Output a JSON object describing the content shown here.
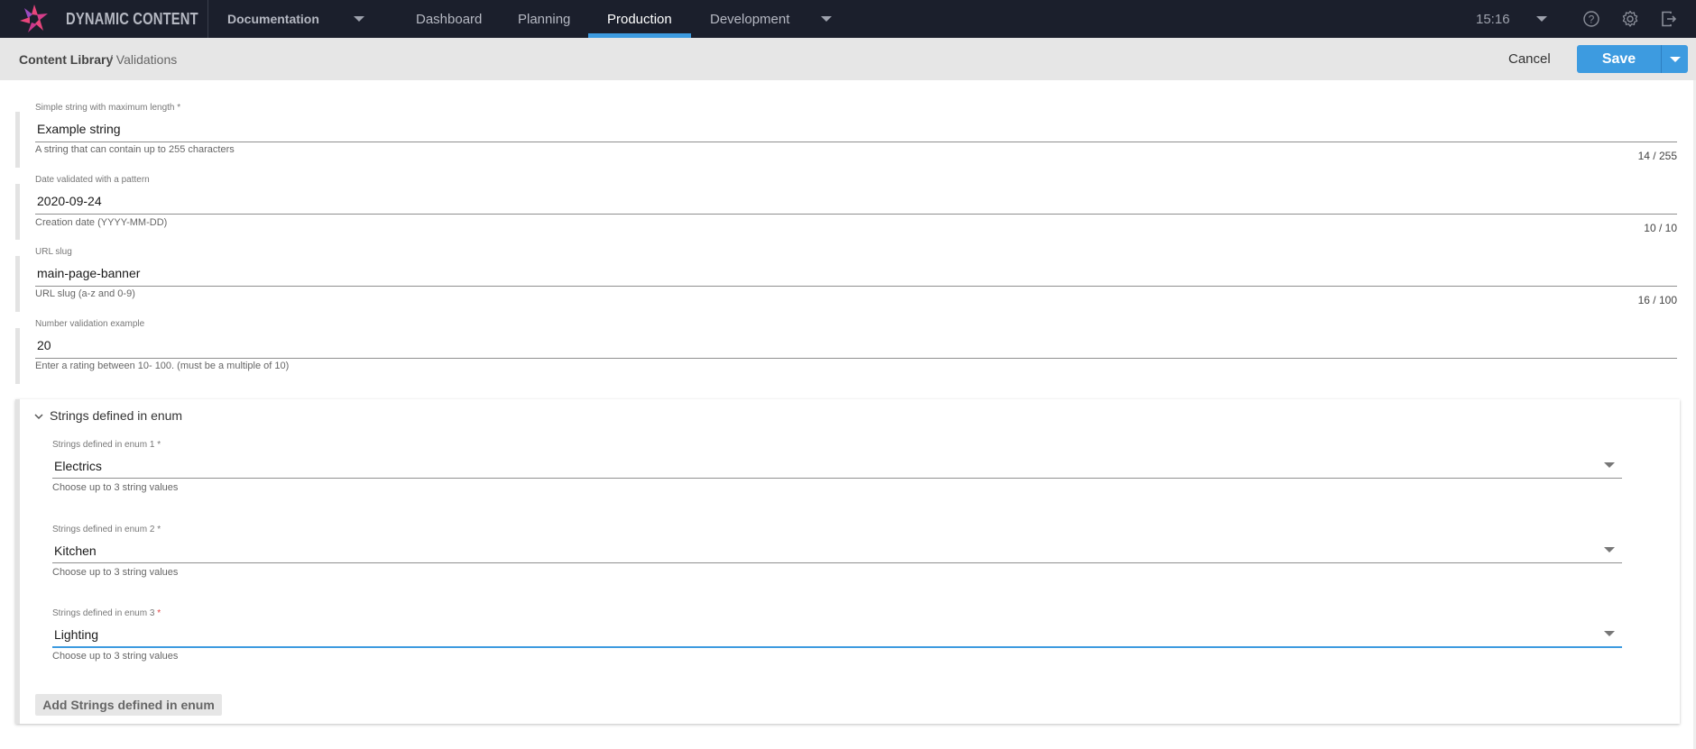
{
  "app": {
    "brand": "DYNAMIC CONTENT",
    "hub": "Documentation",
    "nav": [
      "Dashboard",
      "Planning",
      "Production",
      "Development"
    ],
    "active_nav": "Production",
    "clock": "15:16",
    "icons": [
      "help-icon",
      "settings-icon",
      "logout-icon"
    ],
    "accent": "#3d9be0"
  },
  "breadcrumb": {
    "root": "Content Library",
    "current": "/ Validations"
  },
  "actions": {
    "cancel": "Cancel",
    "save": "Save"
  },
  "fields": [
    {
      "label": "Simple string with maximum length *",
      "value": "Example string",
      "help": "A string that can contain up to 255 characters",
      "count": "14 / 255"
    },
    {
      "label": "Date validated with a pattern",
      "value": "2020-09-24",
      "help": "Creation date (YYYY-MM-DD)",
      "count": "10 / 10"
    },
    {
      "label": "URL slug",
      "value": "main-page-banner",
      "help": "URL slug (a-z and 0-9)",
      "count": "16 / 100"
    },
    {
      "label": "Number validation example",
      "value": "20",
      "help": "Enter a rating between 10- 100. (must be a multiple of 10)"
    }
  ],
  "enum_section": {
    "title": "Strings defined in enum",
    "items": [
      {
        "label": "Strings defined in enum 1",
        "required": "*",
        "value": "Electrics",
        "help": "Choose up to 3 string values"
      },
      {
        "label": "Strings defined in enum 2",
        "required": "*",
        "value": "Kitchen",
        "help": "Choose up to 3 string values"
      },
      {
        "label": "Strings defined in enum 3",
        "required": "*",
        "value": "Lighting",
        "help": "Choose up to 3 string values"
      }
    ],
    "add_button": "Add Strings defined in enum"
  }
}
